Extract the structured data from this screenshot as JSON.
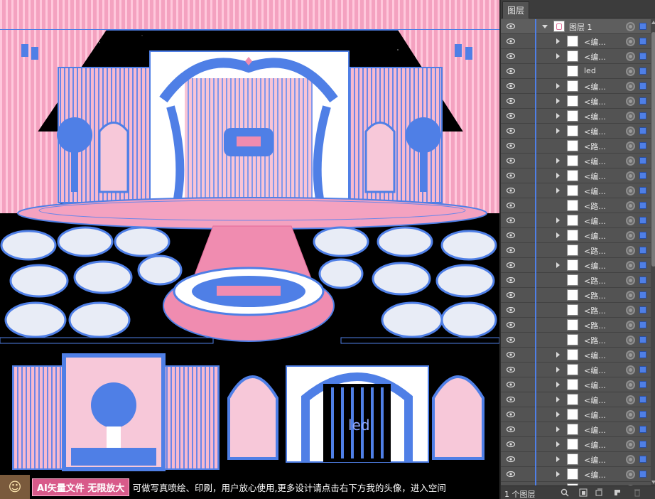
{
  "panel": {
    "tab_label": "图层",
    "layer_count": "1 个图层",
    "top_layer": {
      "name": "图层 1"
    },
    "rows": [
      {
        "name": "<编...",
        "expandable": true
      },
      {
        "name": "<编...",
        "expandable": true
      },
      {
        "name": "led",
        "expandable": false
      },
      {
        "name": "<编...",
        "expandable": true
      },
      {
        "name": "<编...",
        "expandable": true
      },
      {
        "name": "<编...",
        "expandable": true
      },
      {
        "name": "<编...",
        "expandable": true
      },
      {
        "name": "<路...",
        "expandable": false
      },
      {
        "name": "<编...",
        "expandable": true
      },
      {
        "name": "<编...",
        "expandable": true
      },
      {
        "name": "<编...",
        "expandable": true
      },
      {
        "name": "<路...",
        "expandable": false
      },
      {
        "name": "<编...",
        "expandable": true
      },
      {
        "name": "<编...",
        "expandable": true
      },
      {
        "name": "<路...",
        "expandable": false
      },
      {
        "name": "<编...",
        "expandable": true
      },
      {
        "name": "<路...",
        "expandable": false
      },
      {
        "name": "<路...",
        "expandable": false
      },
      {
        "name": "<路...",
        "expandable": false
      },
      {
        "name": "<路...",
        "expandable": false
      },
      {
        "name": "<路...",
        "expandable": false
      },
      {
        "name": "<编...",
        "expandable": true
      },
      {
        "name": "<编...",
        "expandable": true
      },
      {
        "name": "<编...",
        "expandable": true
      },
      {
        "name": "<编...",
        "expandable": true
      },
      {
        "name": "<编...",
        "expandable": true
      },
      {
        "name": "<编...",
        "expandable": true
      },
      {
        "name": "<编...",
        "expandable": true
      },
      {
        "name": "<编...",
        "expandable": true
      },
      {
        "name": "<编...",
        "expandable": true
      },
      {
        "name": "<编...",
        "expandable": true
      }
    ]
  },
  "artboard": {
    "led_label": "led"
  },
  "banner": {
    "tag": "AI矢量文件 无限放大",
    "text": "可做写真喷绘、印刷，用户放心使用,更多设计请点击右下方我的头像，进入空间"
  },
  "colors": {
    "pink": "#f08cb0",
    "selection_blue": "#4f7fe6",
    "panel_bg": "#535353"
  }
}
